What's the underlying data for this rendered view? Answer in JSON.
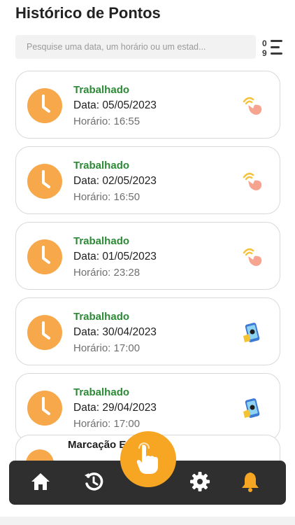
{
  "page": {
    "title": "Histórico de Pontos"
  },
  "search": {
    "placeholder": "Pesquise uma data, um horário ou um estad..."
  },
  "records": [
    {
      "status": "Trabalhado",
      "date": "Data: 05/05/2023",
      "time": "Horário: 16:55",
      "method_icon": "hand-tap-icon"
    },
    {
      "status": "Trabalhado",
      "date": "Data: 02/05/2023",
      "time": "Horário: 16:50",
      "method_icon": "hand-tap-icon"
    },
    {
      "status": "Trabalhado",
      "date": "Data: 01/05/2023",
      "time": "Horário: 23:28",
      "method_icon": "hand-tap-icon"
    },
    {
      "status": "Trabalhado",
      "date": "Data: 30/04/2023",
      "time": "Horário: 17:00",
      "method_icon": "phone-app-icon"
    },
    {
      "status": "Trabalhado",
      "date": "Data: 29/04/2023",
      "time": "Horário: 17:00",
      "method_icon": "phone-app-icon"
    }
  ],
  "partial_record": {
    "status": "Marcação Editada"
  },
  "nav": {
    "items": [
      "home-icon",
      "history-icon",
      "punch-clock-icon",
      "gear-icon",
      "bell-icon"
    ],
    "active": "bell-icon"
  },
  "colors": {
    "accent": "#f7a623",
    "status_green": "#2c8a35",
    "navbar": "#2f2f2f",
    "clock": "#f7a84a"
  }
}
